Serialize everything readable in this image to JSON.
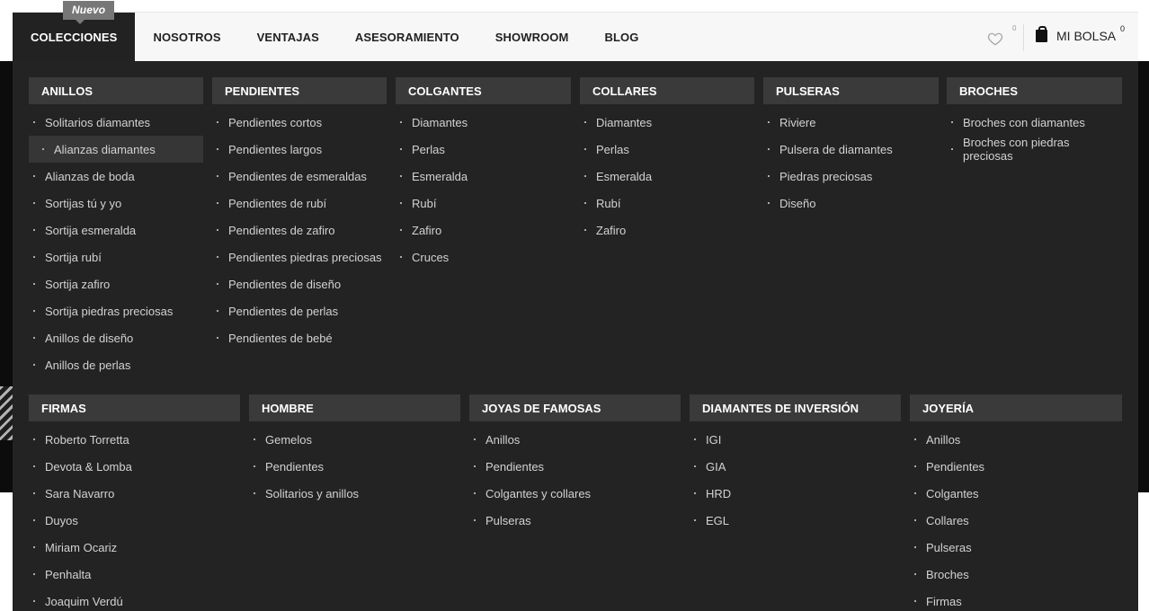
{
  "nav": {
    "items": [
      {
        "label": "COLECCIONES"
      },
      {
        "label": "NOSOTROS"
      },
      {
        "label": "VENTAJAS"
      },
      {
        "label": "ASESORAMIENTO"
      },
      {
        "label": "SHOWROOM"
      },
      {
        "label": "BLOG"
      }
    ],
    "badge": "Nuevo",
    "wishlist_count": "0",
    "bag_label": "MI BOLSA",
    "bag_count": "0"
  },
  "menu": {
    "row1": [
      {
        "title": "ANILLOS",
        "items": [
          "Solitarios diamantes",
          "Alianzas diamantes",
          "Alianzas de boda",
          "Sortijas tú y yo",
          "Sortija esmeralda",
          "Sortija rubí",
          "Sortija zafiro",
          "Sortija piedras preciosas",
          "Anillos de diseño",
          "Anillos de perlas"
        ]
      },
      {
        "title": "PENDIENTES",
        "items": [
          "Pendientes cortos",
          "Pendientes largos",
          "Pendientes de esmeraldas",
          "Pendientes de rubí",
          "Pendientes de zafiro",
          "Pendientes piedras preciosas",
          "Pendientes de diseño",
          "Pendientes de perlas",
          "Pendientes de bebé"
        ]
      },
      {
        "title": "COLGANTES",
        "items": [
          "Diamantes",
          "Perlas",
          "Esmeralda",
          "Rubí",
          "Zafiro",
          "Cruces"
        ]
      },
      {
        "title": "COLLARES",
        "items": [
          "Diamantes",
          "Perlas",
          "Esmeralda",
          "Rubí",
          "Zafiro"
        ]
      },
      {
        "title": "PULSERAS",
        "items": [
          "Riviere",
          "Pulsera de diamantes",
          "Piedras preciosas",
          "Diseño"
        ]
      },
      {
        "title": "BROCHES",
        "items": [
          "Broches con diamantes",
          "Broches con piedras preciosas"
        ]
      }
    ],
    "row2": [
      {
        "title": "FIRMAS",
        "items": [
          "Roberto Torretta",
          "Devota & Lomba",
          "Sara Navarro",
          "Duyos",
          "Miriam Ocariz",
          "Penhalta",
          "Joaquim Verdú"
        ]
      },
      {
        "title": "HOMBRE",
        "items": [
          "Gemelos",
          "Pendientes",
          "Solitarios y anillos"
        ]
      },
      {
        "title": "JOYAS DE FAMOSAS",
        "items": [
          "Anillos",
          "Pendientes",
          "Colgantes y collares",
          "Pulseras"
        ]
      },
      {
        "title": "DIAMANTES DE INVERSIÓN",
        "items": [
          "IGI",
          "GIA",
          "HRD",
          "EGL"
        ]
      },
      {
        "title": "JOYERÍA",
        "items": [
          "Anillos",
          "Pendientes",
          "Colgantes",
          "Collares",
          "Pulseras",
          "Broches",
          "Firmas"
        ]
      }
    ]
  }
}
